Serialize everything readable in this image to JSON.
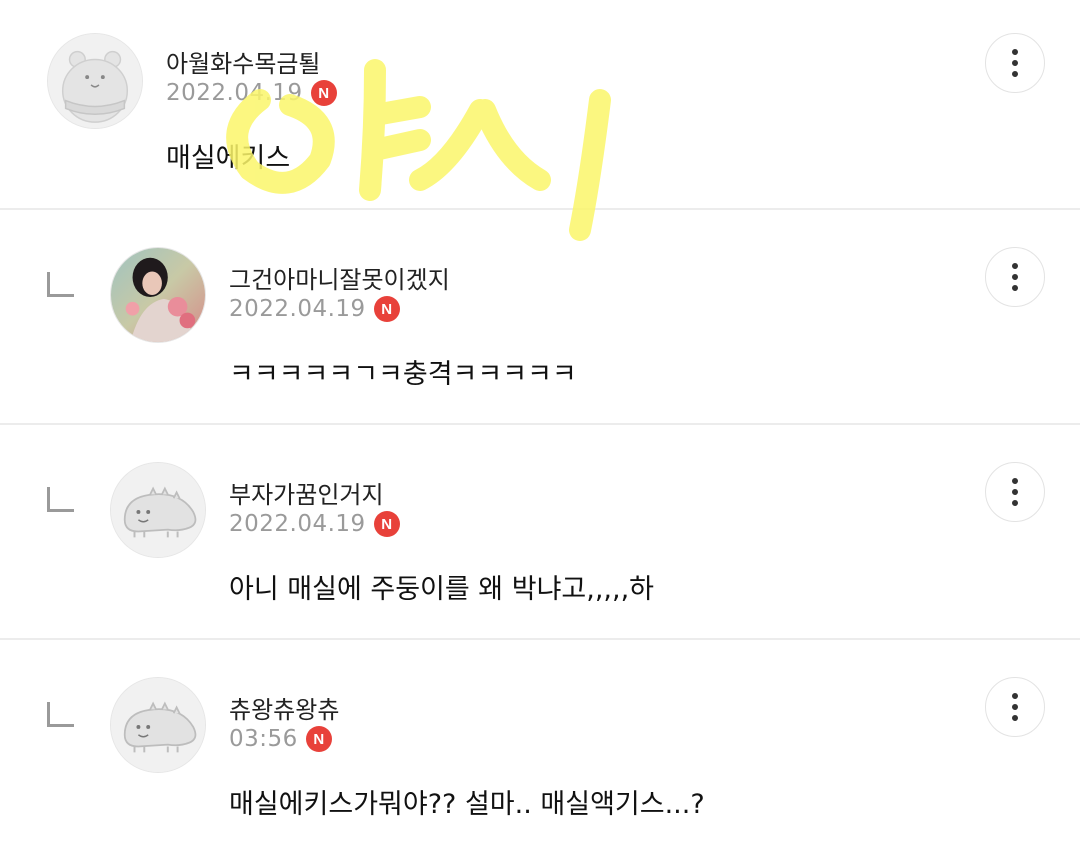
{
  "comments": [
    {
      "nickname": "아월화수목금퇼",
      "date": "2022.04.19",
      "badge": "N",
      "text": "매실에키스",
      "avatar_icon": "hamster-avatar-icon",
      "is_reply": false
    },
    {
      "nickname": "그건아마니잘못이겠지",
      "date": "2022.04.19",
      "badge": "N",
      "text": "ㅋㅋㅋㅋㅋㄱㅋ충격ㅋㅋㅋㅋㅋ",
      "avatar_icon": "profile-photo-avatar",
      "is_reply": true
    },
    {
      "nickname": "부자가꿈인거지",
      "date": "2022.04.19",
      "badge": "N",
      "text": "아니 매실에 주둥이를 왜 박냐고,,,,,하",
      "avatar_icon": "lizard-avatar-icon",
      "is_reply": true
    },
    {
      "nickname": "츄왕츄왕츄",
      "date": "03:56",
      "badge": "N",
      "text": "매실에키스가뭐야?? 설마.. 매실액기스...?",
      "avatar_icon": "lizard-avatar-icon",
      "is_reply": true
    }
  ],
  "colors": {
    "badge": "#e8413a",
    "date": "#9a9a9a",
    "divider": "#ececec",
    "highlight_overlay": "#fbf66a"
  },
  "more_icon": "more-vertical-icon",
  "reply_icon": "reply-arrow-icon"
}
